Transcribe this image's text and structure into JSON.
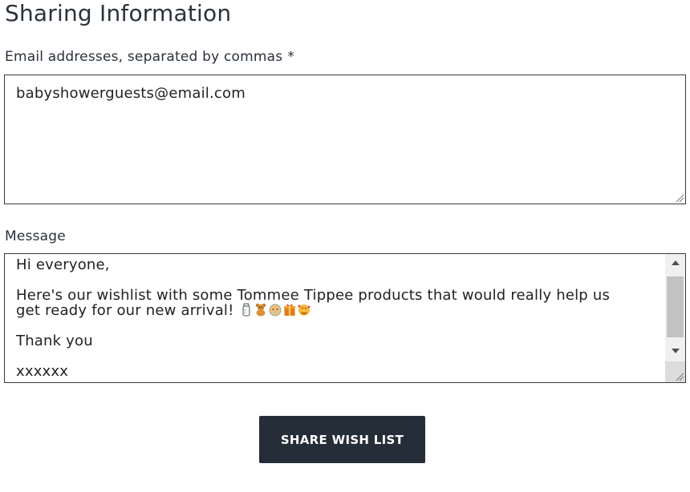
{
  "form": {
    "title": "Sharing Information",
    "email": {
      "label": "Email addresses, separated by commas",
      "required_marker": "*",
      "value": "babyshowerguests@email.com"
    },
    "message": {
      "label": "Message",
      "lines": {
        "greeting": "Hi everyone,",
        "body_1": "Here's our wishlist with some Tommee Tippee products that would really help us",
        "body_2": "get ready for our new arrival!",
        "thanks": "Thank you",
        "signoff": "xxxxxx"
      },
      "emojis": [
        "baby-bottle-icon",
        "teddy-bear-icon",
        "baby-face-icon",
        "gift-icon",
        "smiling-face-hearts-icon"
      ]
    },
    "submit_label": "SHARE WISH LIST"
  }
}
